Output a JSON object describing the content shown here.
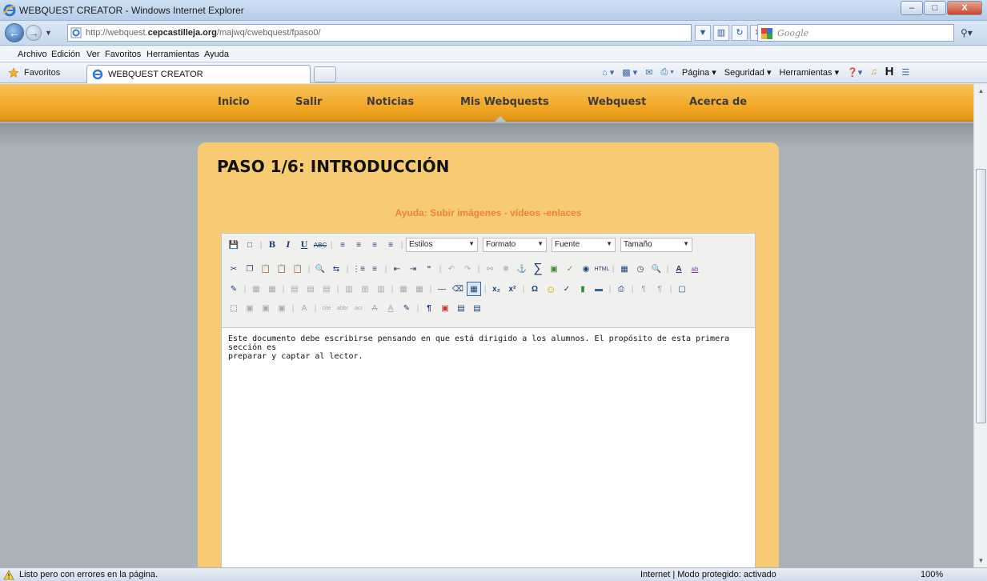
{
  "window": {
    "title": "WEBQUEST CREATOR - Windows Internet Explorer",
    "controls": [
      "–",
      "□",
      "X"
    ]
  },
  "address_bar": {
    "url_prefix": "http://webquest.",
    "url_domain": "cepcastilleja.org",
    "url_path": "/majwq/cwebquest/fpaso0/",
    "search_placeholder": "Google"
  },
  "menu": [
    "Archivo",
    "Edición",
    "Ver",
    "Favoritos",
    "Herramientas",
    "Ayuda"
  ],
  "favorites_bar": {
    "favorites_label": "Favoritos",
    "tab_label": "WEBQUEST CREATOR",
    "commands": [
      "Página ▾",
      "Seguridad ▾",
      "Herramientas ▾"
    ]
  },
  "site_nav": [
    "Inicio",
    "Salir",
    "Noticias",
    "Mis Webquests",
    "Webquest",
    "Acerca de"
  ],
  "page": {
    "heading": "PASO 1/6: INTRODUCCIÓN",
    "help_link": "Ayuda: Subir imágenes - vídeos -enlaces"
  },
  "editor": {
    "selects": [
      "Estilos",
      "Formato",
      "Fuente",
      "Tamaño"
    ],
    "content_line1": "Este documento debe escribirse pensando en que está dirigido a los alumnos. El propósito de esta primera sección es",
    "content_line2": "preparar y captar al lector."
  },
  "status_bar": {
    "message": "Listo pero con errores en la página.",
    "zone": "Internet | Modo protegido: activado",
    "zoom": "100%"
  },
  "colors": {
    "nav_orange": "#f0a420",
    "card_yellow": "#f6cb71",
    "help_link_orange": "#f47f3e",
    "page_gray": "#a9b2b9"
  }
}
